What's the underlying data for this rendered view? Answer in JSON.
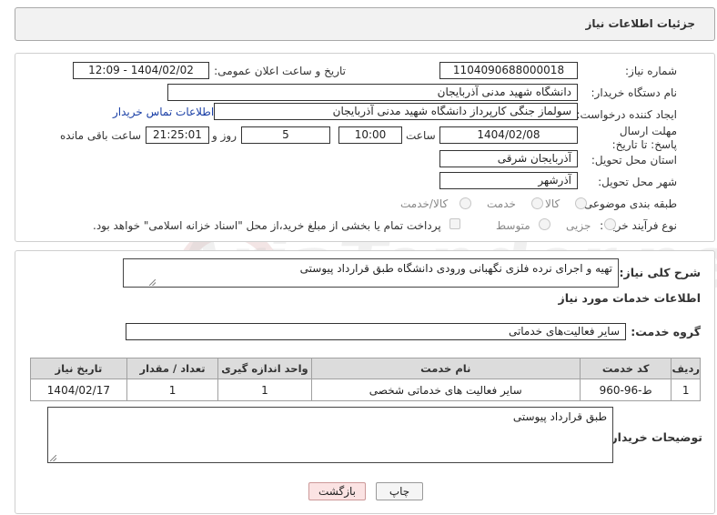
{
  "header": {
    "title": "جزئیات اطلاعات نیاز"
  },
  "form": {
    "need_number_label": "شماره نیاز:",
    "need_number": "1104090688000018",
    "announce_label": "تاریخ و ساعت اعلان عمومی:",
    "announce_value": "1404/02/02 - 12:09",
    "buyer_org_label": "نام دستگاه خریدار:",
    "buyer_org": "دانشگاه شهید مدنی آذربایجان",
    "creator_label": "ایجاد کننده درخواست:",
    "creator": "سولماز جنگی کارپرداز دانشگاه شهید مدنی آذربایجان",
    "contact_link": "اطلاعات تماس خریدار",
    "deadline_label": "مهلت ارسال پاسخ: تا تاریخ:",
    "deadline_date": "1404/02/08",
    "time_label": "ساعت",
    "deadline_time": "10:00",
    "days_value": "5",
    "days_label": "روز و",
    "remaining_time": "21:25:01",
    "remaining_label": "ساعت باقی مانده",
    "province_label": "استان محل تحویل:",
    "province": "آذربایجان شرقی",
    "city_label": "شهر محل تحویل:",
    "city": "آذرشهر",
    "category_label": "طبقه بندی موضوعی:",
    "category_options": [
      "کالا",
      "خدمت",
      "کالا/خدمت"
    ],
    "process_label": "نوع فرآیند خرید :",
    "process_options": [
      "جزیی",
      "متوسط"
    ],
    "payment_note": "پرداخت تمام یا بخشی از مبلغ خرید،از محل \"اسناد خزانه اسلامی\" خواهد بود."
  },
  "summary": {
    "label": "شرح کلی نیاز:",
    "value": "تهیه و اجرای نرده فلزی نگهبانی ورودی دانشگاه طبق قرارداد پیوستی"
  },
  "services": {
    "section_title": "اطلاعات خدمات مورد نیاز",
    "group_label": "گروه خدمت:",
    "group_value": "سایر فعالیت‌های خدماتی",
    "columns": [
      "ردیف",
      "کد خدمت",
      "نام خدمت",
      "واحد اندازه گیری",
      "تعداد / مقدار",
      "تاریخ نیاز"
    ],
    "rows": [
      [
        "1",
        "ط-96-960",
        "سایر فعالیت های خدماتی شخصی",
        "1",
        "1",
        "1404/02/17"
      ]
    ]
  },
  "buyer_notes": {
    "label": "توضیحات خریدار:",
    "value": "طبق قرارداد پیوستی"
  },
  "buttons": {
    "print": "چاپ",
    "back": "بازگشت"
  },
  "watermark": {
    "text": "AriaTender.net"
  },
  "colors": {
    "link": "#1a3fa6",
    "back_button_bg": "#fbe3e3",
    "header_bg": "#f2f2f2"
  }
}
